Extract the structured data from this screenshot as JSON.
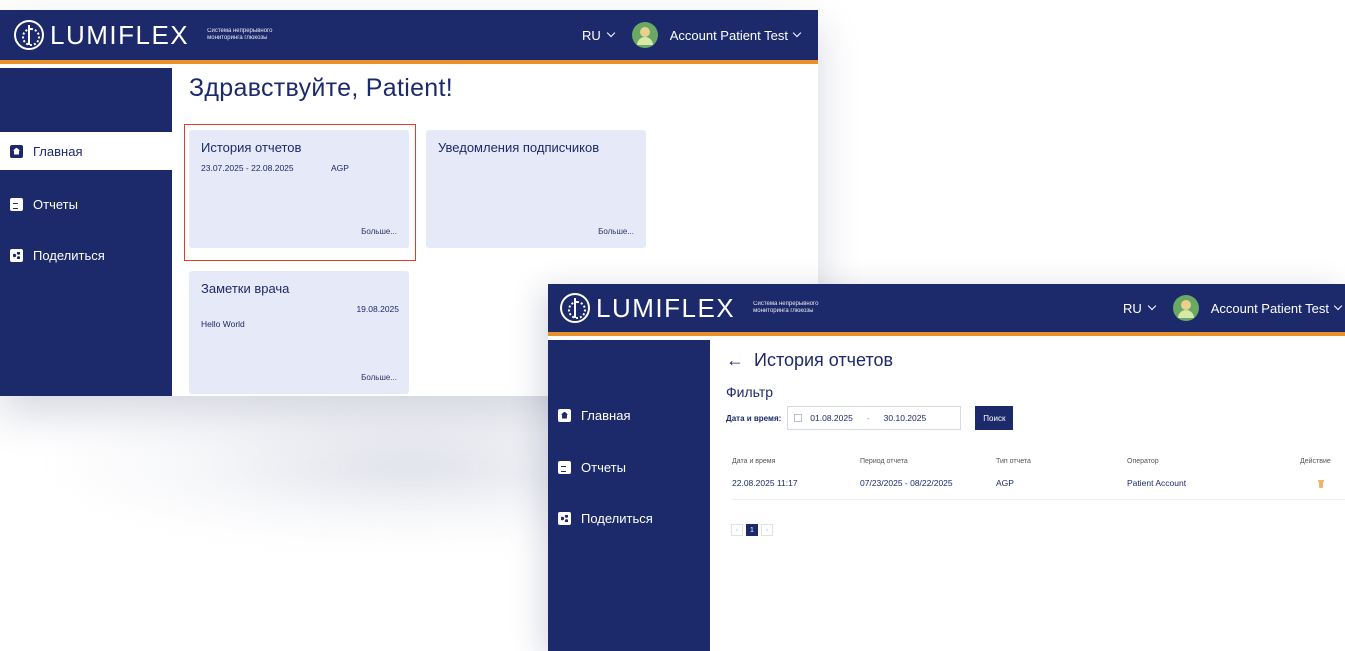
{
  "brand": {
    "logo_text": "LUMIFLEX",
    "tagline": "Система непрерывного мониторинга глюкозы"
  },
  "header": {
    "lang": "RU",
    "account": "Account Patient Test"
  },
  "nav": {
    "home": "Главная",
    "reports": "Отчеты",
    "share": "Поделиться"
  },
  "dashboard": {
    "greeting": "Здравствуйте, Patient!",
    "report_card": {
      "title": "История отчетов",
      "period": "23.07.2025 - 22.08.2025",
      "type": "AGP",
      "more": "Больше..."
    },
    "notif_card": {
      "title": "Уведомления подписчиков",
      "more": "Больше..."
    },
    "notes_card": {
      "title": "Заметки врача",
      "date": "19.08.2025",
      "text": "Hello World",
      "more": "Больше..."
    }
  },
  "history": {
    "title": "История отчетов",
    "filter_title": "Фильтр",
    "date_label": "Дата и время:",
    "date_from": "01.08.2025",
    "date_sep": "-",
    "date_to": "30.10.2025",
    "search_button": "Поиск",
    "columns": [
      "Дата и время",
      "Период отчета",
      "Тип отчета",
      "Оператор",
      "Действие"
    ],
    "rows": [
      {
        "datetime": "22.08.2025 11:17",
        "period": "07/23/2025 - 08/22/2025",
        "type": "AGP",
        "operator": "Patient Account"
      }
    ],
    "pager": {
      "prev": "‹",
      "current": "1",
      "next": "›"
    }
  },
  "colors": {
    "navy": "#1c2a6b",
    "accent_orange": "#e8902a",
    "card_bg": "#e6e9f7",
    "highlight_red": "#e23b2b",
    "delete_icon": "#f6b067"
  },
  "icons": [
    "logo-icon",
    "chevron-down-icon",
    "avatar",
    "home-icon",
    "reports-icon",
    "share-icon",
    "back-arrow-icon",
    "calendar-icon",
    "trash-icon"
  ]
}
